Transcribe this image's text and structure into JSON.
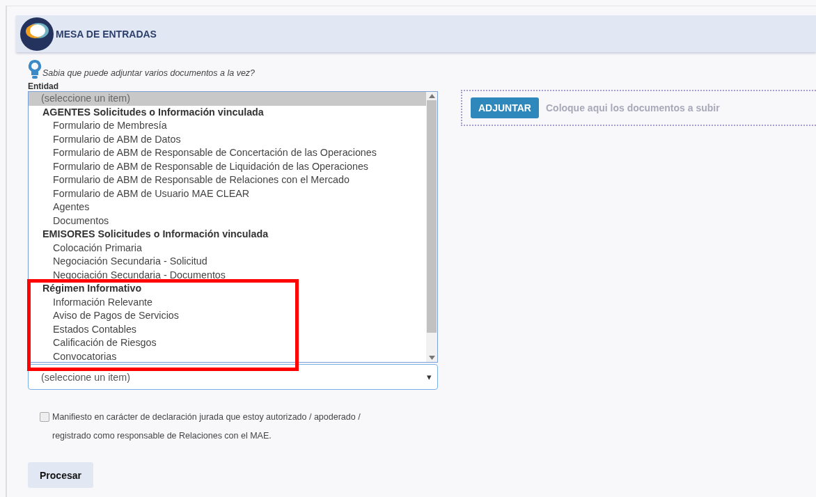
{
  "header": {
    "title": "MESA DE ENTRADAS"
  },
  "tip": {
    "text": "Sabia que puede adjuntar varios documentos a la vez?"
  },
  "entity_label": "Entidad",
  "listbox": {
    "items": [
      {
        "label": "(seleccione un item)",
        "kind": "option",
        "selected": true
      },
      {
        "label": "AGENTES Solicitudes o Información vinculada",
        "kind": "group",
        "children": [
          {
            "label": "Formulario de Membresía",
            "selected": false
          },
          {
            "label": "Formulario de ABM de Datos",
            "selected": false
          },
          {
            "label": "Formulario de ABM de Responsable de Concertación de las Operaciones",
            "selected": false
          },
          {
            "label": "Formulario de ABM de Responsable de Liquidación de las Operaciones",
            "selected": false
          },
          {
            "label": "Formulario de ABM de Responsable de Relaciones con el Mercado",
            "selected": false
          },
          {
            "label": "Formulario de ABM de Usuario MAE CLEAR",
            "selected": false
          },
          {
            "label": "Agentes",
            "selected": false
          },
          {
            "label": "Documentos",
            "selected": false
          }
        ]
      },
      {
        "label": "EMISORES Solicitudes o Información vinculada",
        "kind": "group",
        "children": [
          {
            "label": "Colocación Primaria",
            "selected": false
          },
          {
            "label": "Negociación Secundaria - Solicitud",
            "selected": false
          },
          {
            "label": "Negociación Secundaria - Documentos",
            "selected": false
          }
        ]
      },
      {
        "label": "Régimen Informativo",
        "kind": "group",
        "children": [
          {
            "label": "Información Relevante",
            "selected": false
          },
          {
            "label": "Aviso de Pagos de Servicios",
            "selected": false
          },
          {
            "label": "Estados Contables",
            "selected": false
          },
          {
            "label": "Calificación de Riesgos",
            "selected": false
          },
          {
            "label": "Convocatorias",
            "selected": false
          }
        ]
      }
    ]
  },
  "dropdown": {
    "value": "(seleccione un item)",
    "arrow": "▾"
  },
  "upload": {
    "button": "ADJUNTAR",
    "hint": "Coloque aqui los documentos a subir"
  },
  "declaration": {
    "checked": false,
    "text": "Manifiesto en carácter de declaración jurada que estoy autorizado / apoderado / registrado como responsable de Relaciones con el MAE."
  },
  "submit": "Procesar"
}
